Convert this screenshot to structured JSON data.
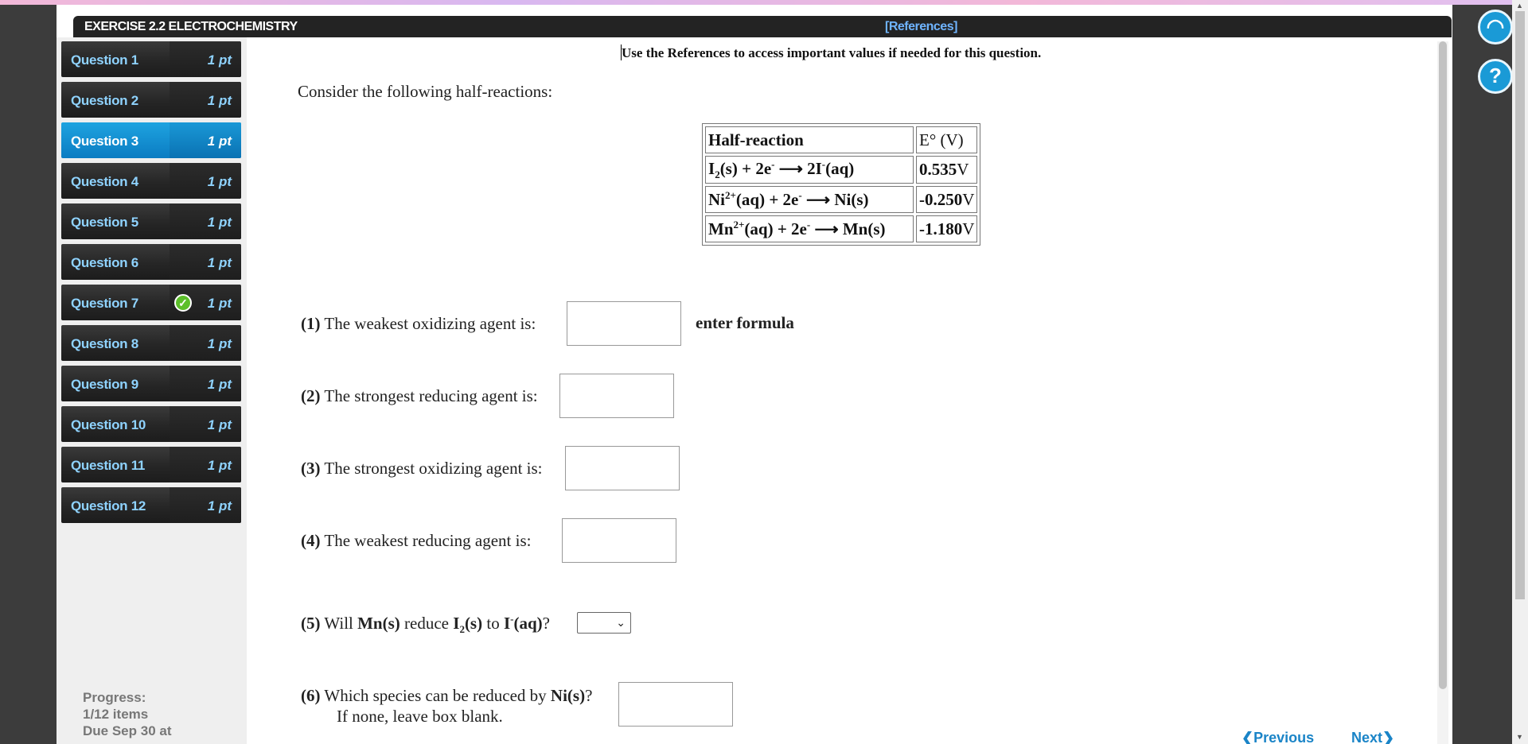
{
  "header": {
    "title": "EXERCISE 2.2 ELECTROCHEMISTRY",
    "references_label": "[References]"
  },
  "sidebar": {
    "questions": [
      {
        "label": "Question 1",
        "points": "1 pt",
        "active": false,
        "complete": false
      },
      {
        "label": "Question 2",
        "points": "1 pt",
        "active": false,
        "complete": false
      },
      {
        "label": "Question 3",
        "points": "1 pt",
        "active": true,
        "complete": false
      },
      {
        "label": "Question 4",
        "points": "1 pt",
        "active": false,
        "complete": false
      },
      {
        "label": "Question 5",
        "points": "1 pt",
        "active": false,
        "complete": false
      },
      {
        "label": "Question 6",
        "points": "1 pt",
        "active": false,
        "complete": false
      },
      {
        "label": "Question 7",
        "points": "1 pt",
        "active": false,
        "complete": true
      },
      {
        "label": "Question 8",
        "points": "1 pt",
        "active": false,
        "complete": false
      },
      {
        "label": "Question 9",
        "points": "1 pt",
        "active": false,
        "complete": false
      },
      {
        "label": "Question 10",
        "points": "1 pt",
        "active": false,
        "complete": false
      },
      {
        "label": "Question 11",
        "points": "1 pt",
        "active": false,
        "complete": false
      },
      {
        "label": "Question 12",
        "points": "1 pt",
        "active": false,
        "complete": false
      }
    ],
    "progress_label": "Progress:",
    "progress_value": "1/12 items",
    "due": "Due Sep 30 at"
  },
  "main": {
    "note": "Use the References to access important values if needed for this question.",
    "intro": "Consider the following half-reactions:",
    "table": {
      "header_reaction": "Half-reaction",
      "header_e": "E° (V)",
      "values": [
        "0.535",
        "-0.250",
        "-1.180"
      ],
      "unit": "V"
    },
    "questions": [
      {
        "num": "(1)",
        "text": "The weakest oxidizing agent is:"
      },
      {
        "num": "(2)",
        "text": "The strongest reducing agent is:"
      },
      {
        "num": "(3)",
        "text": "The strongest oxidizing agent is:"
      },
      {
        "num": "(4)",
        "text": "The weakest reducing agent is:"
      },
      {
        "num": "(5)",
        "text": "Will"
      },
      {
        "num": "(6)",
        "text": "Which species can be reduced by"
      }
    ],
    "hint": "enter formula",
    "q5_mid": "reduce",
    "q5_to": "to",
    "q6_second_line": "If none, leave box blank.",
    "select_value": ""
  },
  "footer": {
    "previous": "Previous",
    "next": "Next"
  },
  "colors": {
    "accent": "#1a9ad6",
    "sidebar_text": "#8fd3ff",
    "check": "#5cbf2a"
  }
}
